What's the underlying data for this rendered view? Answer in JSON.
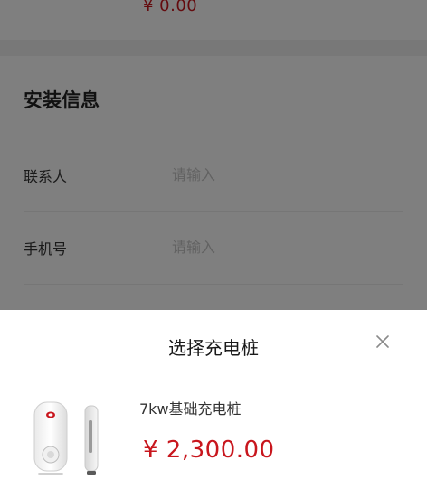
{
  "summary": {
    "price": "¥ 0.00"
  },
  "install_info": {
    "title": "安装信息",
    "fields": [
      {
        "label": "联系人",
        "placeholder": "请输入",
        "value": ""
      },
      {
        "label": "手机号",
        "placeholder": "请输入",
        "value": ""
      }
    ]
  },
  "sheet": {
    "title": "选择充电桩",
    "close_icon": "close-icon",
    "products": [
      {
        "name": "7kw基础充电桩",
        "price": "¥ 2,300.00",
        "image": "charger-image"
      }
    ]
  },
  "colors": {
    "price": "#c8161d",
    "overlay": "rgba(0,0,0,0.5)"
  }
}
